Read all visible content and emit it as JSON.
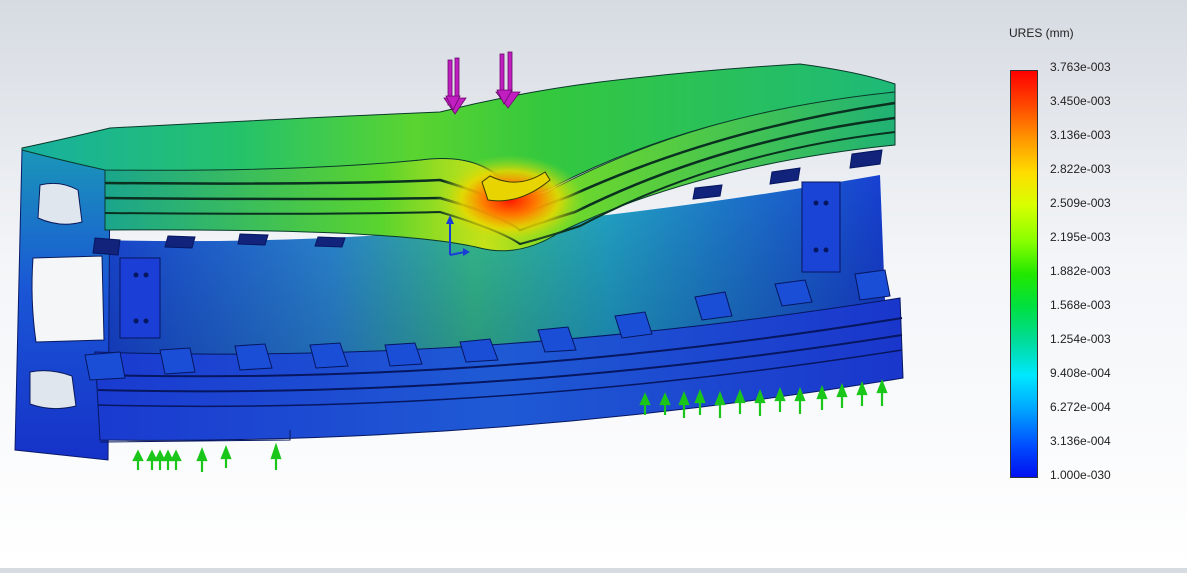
{
  "legend": {
    "title": "URES (mm)",
    "ticks": [
      "3.763e-003",
      "3.450e-003",
      "3.136e-003",
      "2.822e-003",
      "2.509e-003",
      "2.195e-003",
      "1.882e-003",
      "1.568e-003",
      "1.254e-003",
      "9.408e-004",
      "6.272e-004",
      "3.136e-004",
      "1.000e-030"
    ]
  },
  "colors": {
    "max": "#ff0000",
    "mid": "#22e800",
    "min": "#0010f0",
    "load_arrow": "#c01ec0",
    "fixture_arrow": "#19c619",
    "axis_triad": "#1a3dd6"
  }
}
